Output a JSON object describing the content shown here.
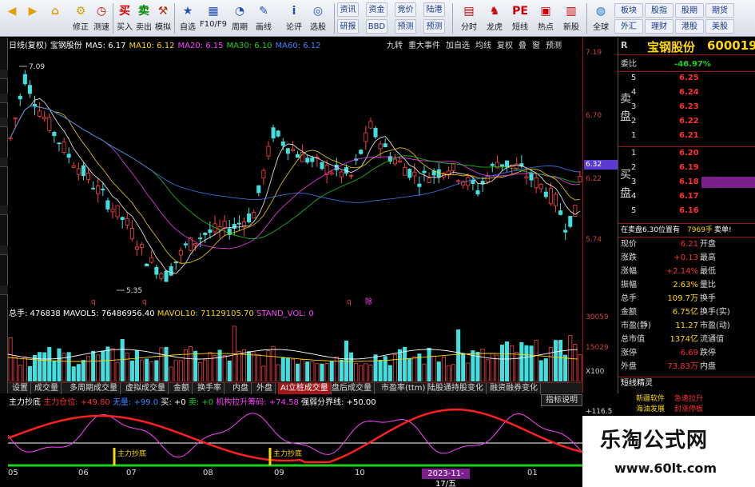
{
  "toolbar": {
    "buttons": [
      "",
      "修正",
      "测速",
      "买入",
      "卖出",
      "模拟",
      "自选",
      "F10/F9",
      "周期",
      "画线",
      "论评",
      "选股"
    ],
    "small_buttons_row1": [
      "资讯",
      "资金",
      "竞价",
      "陆港"
    ],
    "small_buttons_row2": [
      "研报",
      "BBD",
      "预测",
      "预测"
    ],
    "right_buttons": [
      "分时",
      "龙虎",
      "短线",
      "热点",
      "新股",
      "全球"
    ],
    "far_right_row1": [
      "板块",
      "股指",
      "股期",
      "期货"
    ],
    "far_right_row2": [
      "外汇",
      "理财",
      "港股",
      "美股"
    ]
  },
  "main_header": {
    "period": "日线(复权)",
    "stock": "宝钢股份",
    "ma": [
      {
        "label": "MA5: 6.17",
        "color": "#ffffff"
      },
      {
        "label": "MA10: 6.12",
        "color": "#ffd700"
      },
      {
        "label": "MA20: 6.15",
        "color": "#ff40ff"
      },
      {
        "label": "MA30: 6.10",
        "color": "#20d020"
      },
      {
        "label": "MA60: 6.12",
        "color": "#4080ff"
      }
    ],
    "buttons": [
      "九转",
      "重大事件",
      "加自选",
      "均线",
      "复权",
      "叠",
      "窗",
      "预测"
    ]
  },
  "price_axis": {
    "labels": [
      "7.19",
      "6.70",
      "6.22",
      "5.74"
    ],
    "current": "6.32",
    "current_color": "#5a3ad0"
  },
  "main_annotations": {
    "high": "7.09",
    "low": "5.35",
    "q1": "q",
    "q2": "q",
    "q3": "q",
    "q4": "除"
  },
  "volume_header": {
    "label": "总手: 476838",
    "mavol5": "MAVOL5: 76486956.40",
    "mavol10": "MAVOL10: 71129105.70",
    "stand": "STAND_VOL: 0"
  },
  "volume_axis": {
    "labels": [
      "30059",
      "15029",
      "X100"
    ]
  },
  "tabs": [
    "设置",
    "成交量",
    "多周期成交量",
    "虚拟成交量",
    "金额",
    "换手率",
    "内盘",
    "外盘",
    "AI立桩成交量",
    "盘后成交量",
    "市盈率(ttm)",
    "陆股通持股变化",
    "融资融券变化"
  ],
  "active_tab": "AI立桩成交量",
  "indicator_header": {
    "name": "主力抄底",
    "pos": "主力仓位: +49.80",
    "p2": "无量: +99.0",
    "buy": "买: +0",
    "sell": "卖: +0",
    "inst": "机构拉升筹码: +74.58",
    "sep": "强弱分界线: +50.00"
  },
  "indicator_button": "指标说明",
  "indicator_axis": {
    "top": "+116.5"
  },
  "indicator_labels": {
    "l1": "主力抄底",
    "l2": "主力抄底"
  },
  "x_axis": [
    "05",
    "06",
    "07",
    "08",
    "09",
    "10",
    "01"
  ],
  "x_axis_highlight": "2023-11-17/五",
  "right_panel": {
    "r": "R",
    "name": "宝钢股份",
    "code": "600019",
    "weibi_label": "委比",
    "weibi": "-46.97%",
    "sell_label": [
      "卖",
      "盘"
    ],
    "buy_label": [
      "买",
      "盘"
    ],
    "sells": [
      {
        "level": "5",
        "price": "6.25"
      },
      {
        "level": "4",
        "price": "6.24"
      },
      {
        "level": "3",
        "price": "6.23"
      },
      {
        "level": "2",
        "price": "6.22"
      },
      {
        "level": "1",
        "price": "6.21"
      }
    ],
    "buys": [
      {
        "level": "1",
        "price": "6.20"
      },
      {
        "level": "2",
        "price": "6.19"
      },
      {
        "level": "3",
        "price": "6.18"
      },
      {
        "level": "4",
        "price": "6.17"
      },
      {
        "level": "5",
        "price": "6.16"
      }
    ],
    "pending": "在卖盘6.30位置有",
    "pending_qty": "7969手",
    "pending_act": "卖单!",
    "stats": [
      {
        "l": "现价",
        "v": "6.21",
        "l2": "开盘",
        "c": "#ff3030"
      },
      {
        "l": "涨跌",
        "v": "+0.13",
        "l2": "最高",
        "c": "#ff3030"
      },
      {
        "l": "涨幅",
        "v": "+2.14%",
        "l2": "最低",
        "c": "#ff3030"
      },
      {
        "l": "振幅",
        "v": "2.63%",
        "l2": "量比",
        "c": "#ffd700"
      },
      {
        "l": "总手",
        "v": "109.7万",
        "l2": "换手",
        "c": "#ffd700"
      },
      {
        "l": "金额",
        "v": "6.75亿",
        "l2": "换手(实)",
        "c": "#ffd700"
      },
      {
        "l": "市盈(静)",
        "v": "11.27",
        "l2": "市盈(动)",
        "c": "#ffd700"
      },
      {
        "l": "总市值",
        "v": "1374亿",
        "l2": "流通值",
        "c": "#ffd700"
      },
      {
        "l": "涨停",
        "v": "6.69",
        "l2": "跌停",
        "c": "#ff3030"
      },
      {
        "l": "外盘",
        "v": "73.83万",
        "l2": "内盘",
        "c": "#ff3030"
      }
    ],
    "sprite_label": "短线精灵",
    "sprite_rows": [
      {
        "t": "",
        "a": "新疆软件",
        "b": "急速拉升"
      },
      {
        "t": "",
        "a": "海油发展",
        "b": "封涨停板"
      }
    ]
  },
  "logo": {
    "title": "乐淘公式网",
    "url": "www.60lt.com"
  }
}
